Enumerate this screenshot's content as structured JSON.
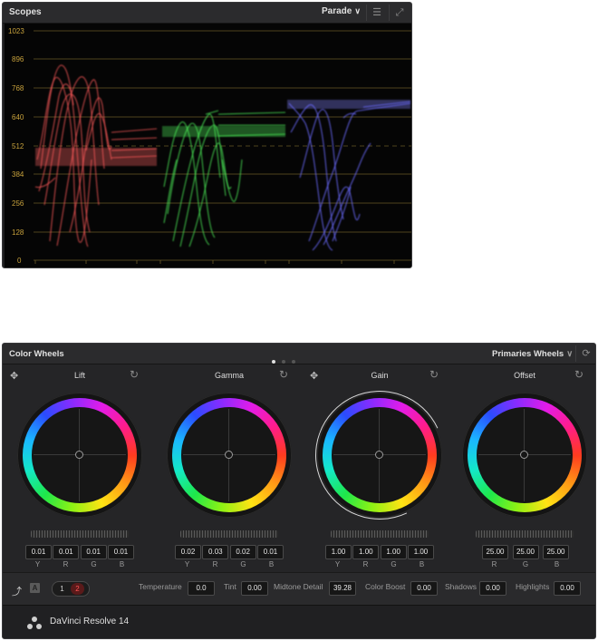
{
  "scopes": {
    "title": "Scopes",
    "mode": "Parade",
    "y_ticks": [
      "1023",
      "896",
      "768",
      "640",
      "512",
      "384",
      "256",
      "128",
      "0"
    ],
    "channel_colors": {
      "red": "#ff5555",
      "green": "#44ee55",
      "blue": "#6666ff"
    },
    "grid_color": "#a08a3a"
  },
  "color_wheels": {
    "title": "Color Wheels",
    "mode": "Primaries Wheels",
    "page_dots": 3,
    "wheels": [
      {
        "label": "Lift",
        "values": [
          "0.01",
          "0.01",
          "0.01",
          "0.01"
        ],
        "channels": [
          "Y",
          "R",
          "G",
          "B"
        ]
      },
      {
        "label": "Gamma",
        "values": [
          "0.02",
          "0.03",
          "0.02",
          "0.01"
        ],
        "channels": [
          "Y",
          "R",
          "G",
          "B"
        ]
      },
      {
        "label": "Gain",
        "values": [
          "1.00",
          "1.00",
          "1.00",
          "1.00"
        ],
        "channels": [
          "Y",
          "R",
          "G",
          "B"
        ]
      },
      {
        "label": "Offset",
        "values": [
          "25.00",
          "25.00",
          "25.00"
        ],
        "channels": [
          "R",
          "G",
          "B"
        ]
      }
    ],
    "bar": {
      "auto_label": "A",
      "page1": "1",
      "page2": "2",
      "temperature_label": "Temperature",
      "temperature_value": "0.0",
      "tint_label": "Tint",
      "tint_value": "0.00",
      "midtone_label": "Midtone Detail",
      "midtone_value": "39.28",
      "boost_label": "Color Boost",
      "boost_value": "0.00",
      "shadows_label": "Shadows",
      "shadows_value": "0.00",
      "highlights_label": "Highlights",
      "highlights_value": "0.00"
    }
  },
  "footer": {
    "brand": "DaVinci Resolve 14"
  }
}
